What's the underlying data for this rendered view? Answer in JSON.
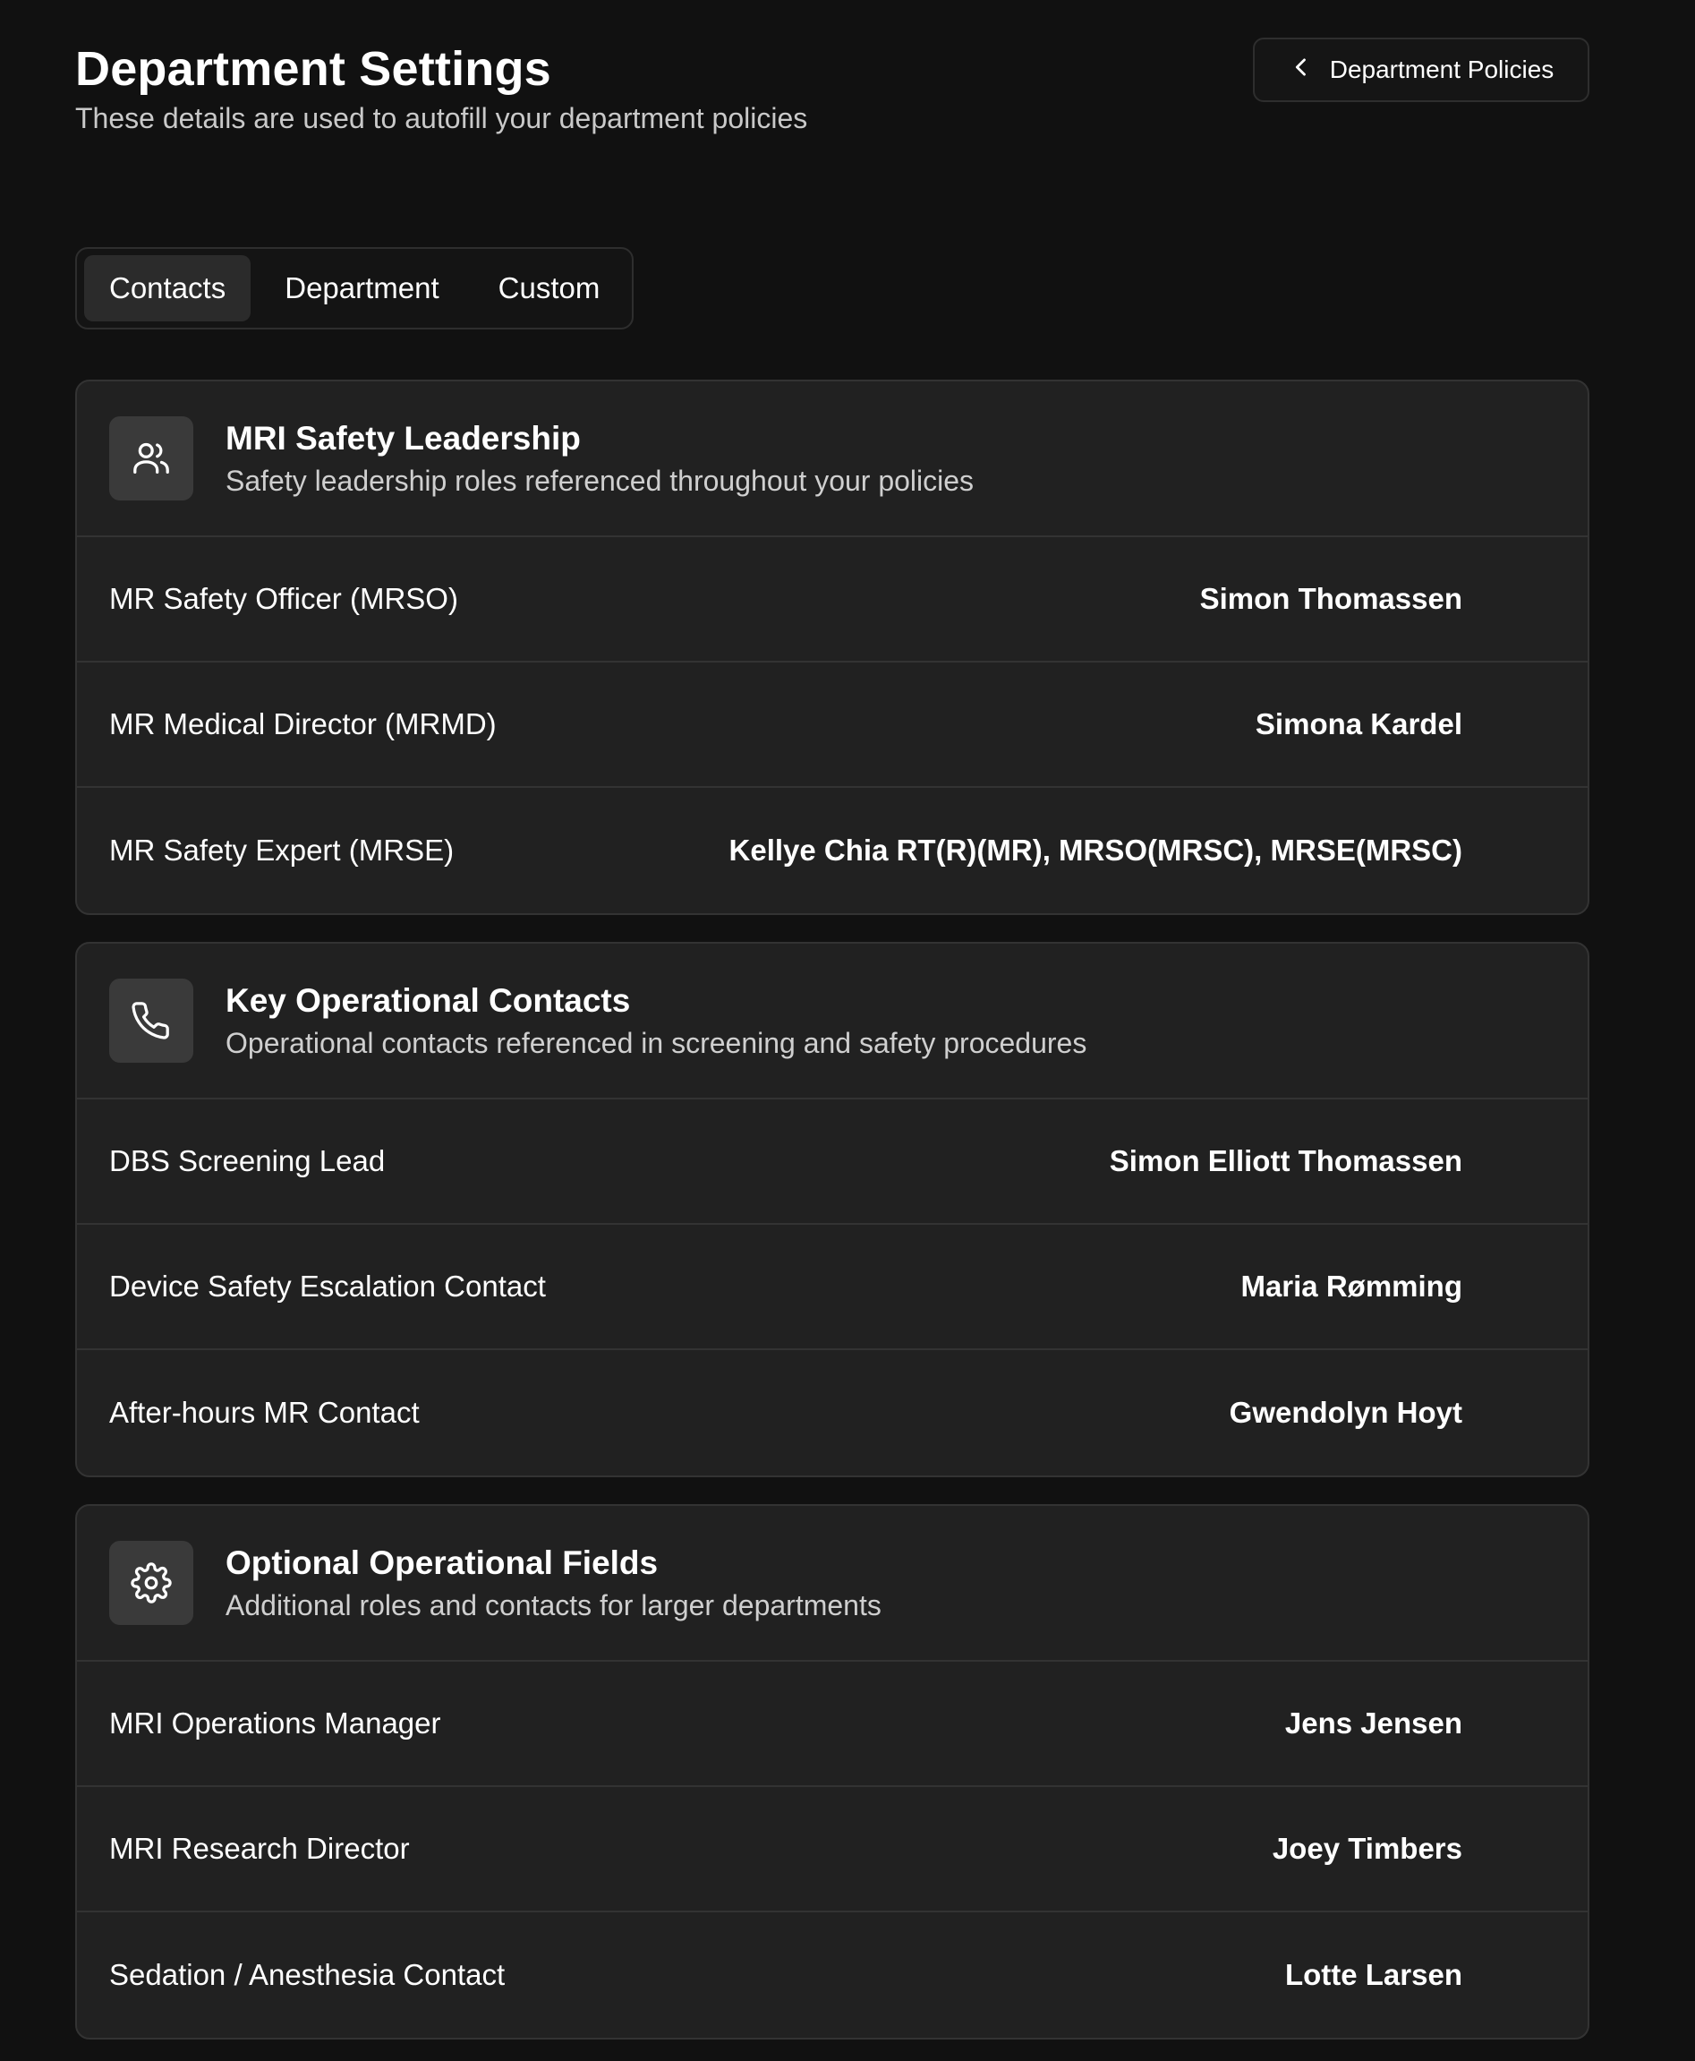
{
  "header": {
    "title": "Department Settings",
    "subtitle": "These details are used to autofill your department policies",
    "back_button_label": "Department Policies"
  },
  "tabs": [
    {
      "label": "Contacts",
      "active": true
    },
    {
      "label": "Department",
      "active": false
    },
    {
      "label": "Custom",
      "active": false
    }
  ],
  "sections": [
    {
      "title": "MRI Safety Leadership",
      "description": "Safety leadership roles referenced throughout your policies",
      "icon": "users-icon",
      "rows": [
        {
          "label": "MR Safety Officer (MRSO)",
          "value": "Simon Thomassen"
        },
        {
          "label": "MR Medical Director (MRMD)",
          "value": "Simona Kardel"
        },
        {
          "label": "MR Safety Expert (MRSE)",
          "value": "Kellye Chia RT(R)(MR), MRSO(MRSC), MRSE(MRSC)"
        }
      ]
    },
    {
      "title": "Key Operational Contacts",
      "description": "Operational contacts referenced in screening and safety procedures",
      "icon": "phone-icon",
      "rows": [
        {
          "label": "DBS Screening Lead",
          "value": "Simon Elliott Thomassen"
        },
        {
          "label": "Device Safety Escalation Contact",
          "value": "Maria Rømming"
        },
        {
          "label": "After-hours MR Contact",
          "value": "Gwendolyn Hoyt"
        }
      ]
    },
    {
      "title": "Optional Operational Fields",
      "description": "Additional roles and contacts for larger departments",
      "icon": "gear-icon",
      "rows": [
        {
          "label": "MRI Operations Manager",
          "value": "Jens Jensen"
        },
        {
          "label": "MRI Research Director",
          "value": "Joey Timbers"
        },
        {
          "label": "Sedation / Anesthesia Contact",
          "value": "Lotte Larsen"
        }
      ]
    }
  ]
}
